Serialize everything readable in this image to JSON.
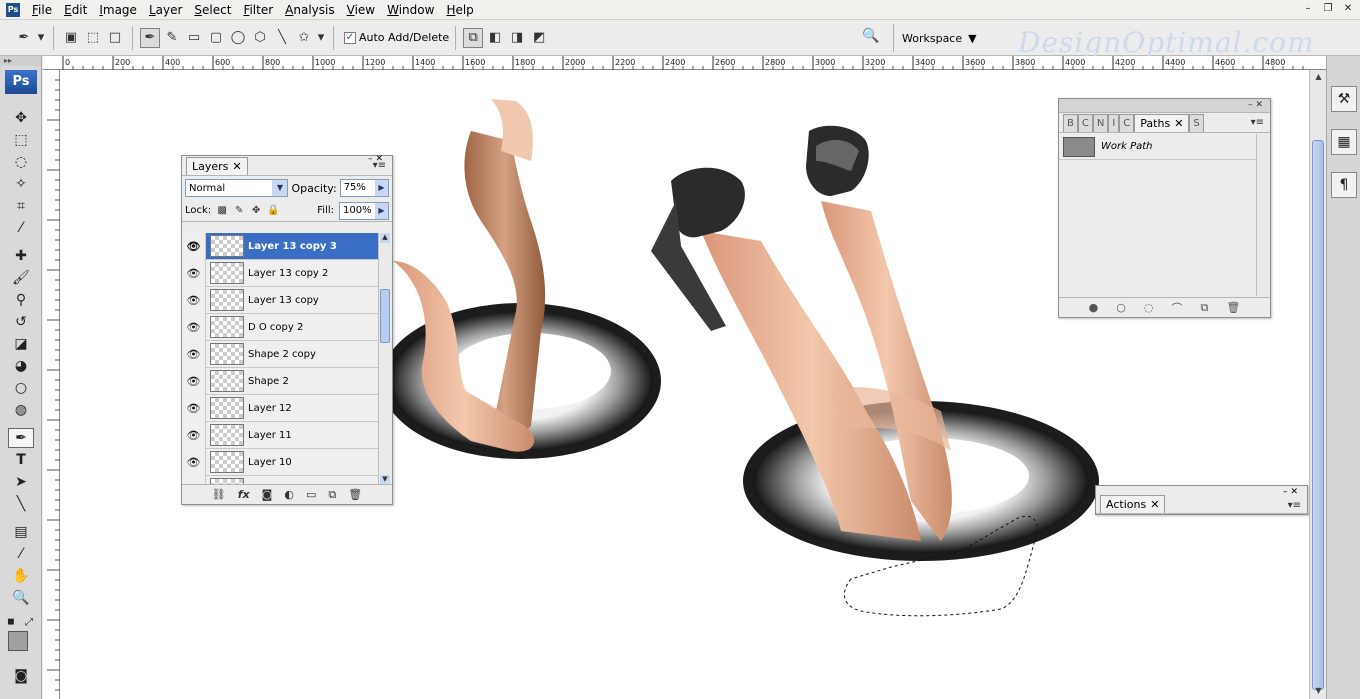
{
  "app": {
    "logo": "Ps"
  },
  "menu": [
    "File",
    "Edit",
    "Image",
    "Layer",
    "Select",
    "Filter",
    "Analysis",
    "View",
    "Window",
    "Help"
  ],
  "window_buttons": [
    "–",
    "❐",
    "✕"
  ],
  "options_bar": {
    "auto_add_label": "Auto Add/Delete",
    "auto_add_checked": true,
    "workspace_label": "Workspace",
    "watermark": "DesignOptimal.com"
  },
  "ruler": {
    "ticks": [
      "0",
      "200",
      "400",
      "600",
      "800",
      "1000",
      "1200",
      "1400",
      "1600",
      "1800",
      "2000",
      "2200",
      "2400",
      "2600",
      "2800",
      "3000",
      "3200",
      "3400",
      "3600",
      "3800",
      "4000",
      "4200",
      "4400",
      "4600",
      "4800"
    ]
  },
  "layers_panel": {
    "tab": "Layers",
    "blend_mode": "Normal",
    "opacity_label": "Opacity:",
    "opacity": "75%",
    "lock_label": "Lock:",
    "fill_label": "Fill:",
    "fill": "100%",
    "layers": [
      {
        "name": "Layer 13 copy 3",
        "selected": true
      },
      {
        "name": "Layer 13 copy 2",
        "selected": false
      },
      {
        "name": "Layer 13 copy",
        "selected": false
      },
      {
        "name": "D O copy 2",
        "selected": false
      },
      {
        "name": "Shape 2 copy",
        "selected": false
      },
      {
        "name": "Shape 2",
        "selected": false
      },
      {
        "name": "Layer 12",
        "selected": false
      },
      {
        "name": "Layer 11",
        "selected": false
      },
      {
        "name": "Layer 10",
        "selected": false
      },
      {
        "name": "",
        "selected": false
      }
    ]
  },
  "paths_panel": {
    "stub_tabs": [
      "B",
      "C",
      "N",
      "I",
      "C",
      "S"
    ],
    "tab": "Paths",
    "paths": [
      {
        "name": "Work Path"
      }
    ]
  },
  "actions_panel": {
    "tab": "Actions"
  },
  "colors": {
    "selection": "#3a6dc4",
    "ring_dark": "#1c1c1c",
    "ring_light": "#e6e6e6",
    "skin": "#e8b592"
  }
}
